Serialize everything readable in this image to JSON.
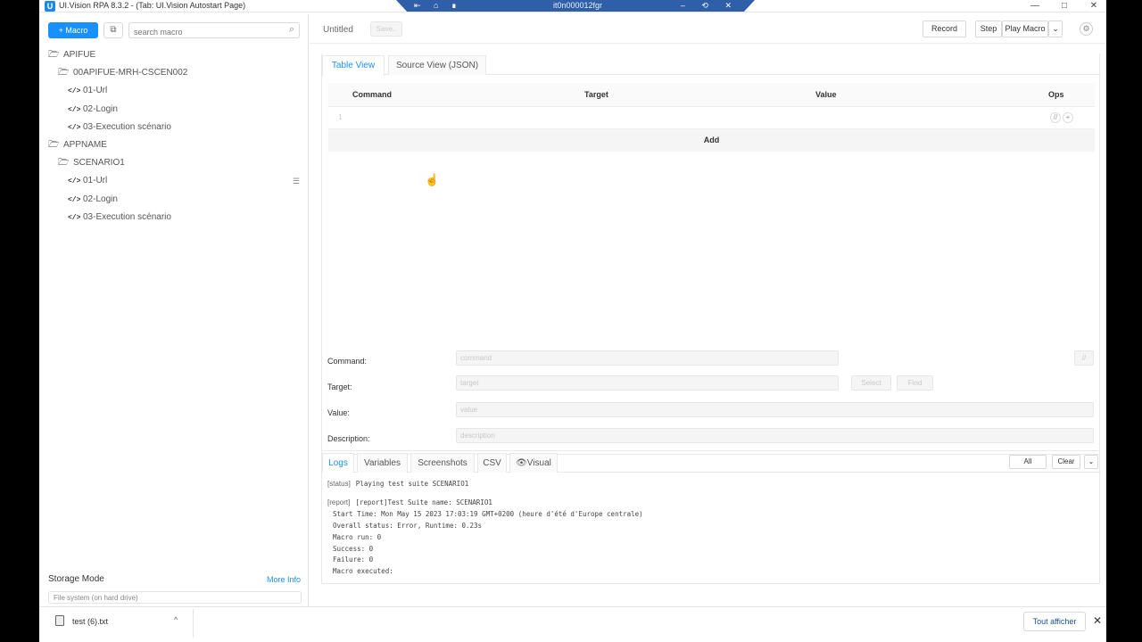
{
  "window": {
    "title": "UI.Vision RPA 8.3.2 - (Tab: UI.Vision Autostart Page)",
    "minimize": "—",
    "maximize": "□",
    "close": "✕"
  },
  "remote_bar": {
    "label": "it0n000012fgr",
    "icons": "⇤ ⌂ ∎",
    "controls": "– ⟲ ✕"
  },
  "sidebar": {
    "macro_button": "+ Macro",
    "folder_icon": "⧉",
    "search_placeholder": "search macro",
    "tree": [
      {
        "label": "APIFUE",
        "type": "folder"
      },
      {
        "label": "00APIFUE-MRH-CSCEN002",
        "type": "folder"
      },
      {
        "label": "01-Url",
        "type": "macro"
      },
      {
        "label": "02-Login",
        "type": "macro"
      },
      {
        "label": "03-Execution scénario",
        "type": "macro"
      },
      {
        "label": "APPNAME",
        "type": "folder"
      },
      {
        "label": "SCENARIO1",
        "type": "folder"
      },
      {
        "label": "01-Url",
        "type": "macro"
      },
      {
        "label": "02-Login",
        "type": "macro"
      },
      {
        "label": "03-Execution scénario",
        "type": "macro"
      }
    ],
    "storage_label": "Storage Mode",
    "more_info": "More Info",
    "storage_value": "File system (on hard drive)"
  },
  "topbar": {
    "title": "Untitled",
    "save": "Save..",
    "record": "Record",
    "step": "Step",
    "play_macro": "Play Macro",
    "dropdown": "⌄",
    "settings_icon": "⚙"
  },
  "editor": {
    "tabs": [
      "Table View",
      "Source View (JSON)"
    ],
    "columns": {
      "command": "Command",
      "target": "Target",
      "value": "Value",
      "ops": "Ops"
    },
    "row_number": "1",
    "ops_comment": "//",
    "ops_add": "+",
    "add_label": "Add",
    "form": {
      "command_label": "Command:",
      "command_placeholder": "command",
      "target_label": "Target:",
      "target_placeholder": "target",
      "select": "Select",
      "find": "Find",
      "value_label": "Value:",
      "value_placeholder": "value",
      "description_label": "Description:",
      "description_placeholder": "description",
      "comment_btn": "//"
    }
  },
  "logs": {
    "tabs": [
      "Logs",
      "Variables",
      "Screenshots",
      "CSV",
      "👁Visual"
    ],
    "filter": "All",
    "clear": "Clear",
    "collapse": "⌄",
    "lines": [
      {
        "tag": "[status]",
        "text": "Playing test suite SCENARIO1"
      },
      {
        "tag": "",
        "text": ""
      },
      {
        "tag": "[report]",
        "text": "[report]Test Suite name: SCENARIO1"
      },
      {
        "tag": "",
        "text": "Start Time: Mon May 15 2023 17:03:19 GMT+0200 (heure d'été d'Europe centrale)"
      },
      {
        "tag": "",
        "text": "Overall status: Error, Runtime: 0.23s"
      },
      {
        "tag": "",
        "text": "Macro run: 0"
      },
      {
        "tag": "",
        "text": "Success: 0"
      },
      {
        "tag": "",
        "text": "Failure: 0"
      },
      {
        "tag": "",
        "text": "Macro executed:"
      }
    ]
  },
  "download_bar": {
    "file": "test (6).txt",
    "chevron": "^",
    "show_all": "Tout afficher",
    "close": "✕"
  },
  "colors": {
    "accent": "#1890ff",
    "remote_bar": "#2f5fa8"
  }
}
